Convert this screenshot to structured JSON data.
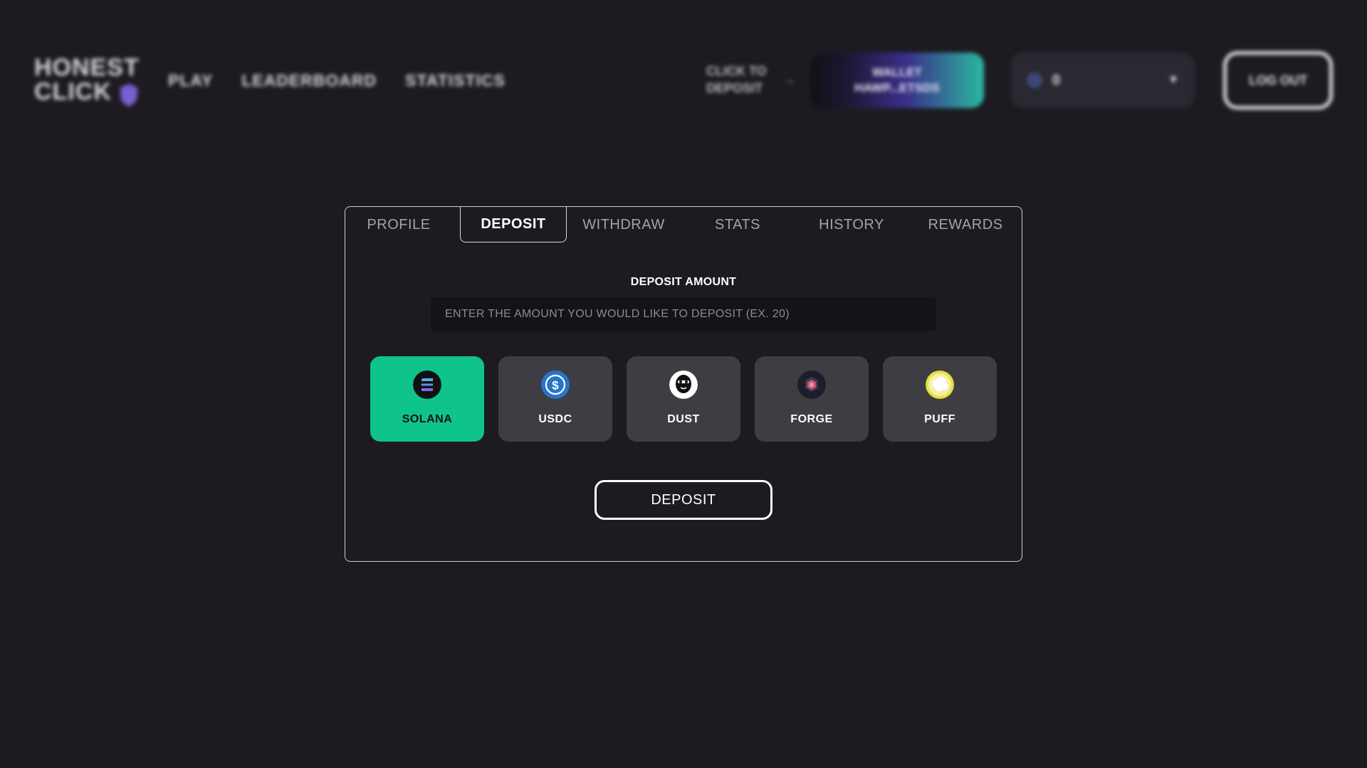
{
  "header": {
    "logo_line1": "HONEST",
    "logo_line2": "CLICK",
    "nav": [
      {
        "label": "PLAY"
      },
      {
        "label": "LEADERBOARD"
      },
      {
        "label": "STATISTICS"
      }
    ],
    "deposit_hint": "CLICK TO DEPOSIT",
    "deposit_hint_arrow": "→",
    "wallet_label": "WALLET",
    "wallet_address": "HAWP...ETSDS",
    "balance_value": "0",
    "balance_caret": "▼",
    "logout_label": "LOG OUT"
  },
  "tabs": [
    {
      "label": "PROFILE"
    },
    {
      "label": "DEPOSIT",
      "active": true
    },
    {
      "label": "WITHDRAW"
    },
    {
      "label": "STATS"
    },
    {
      "label": "HISTORY"
    },
    {
      "label": "REWARDS"
    }
  ],
  "deposit": {
    "amount_label": "DEPOSIT AMOUNT",
    "amount_value": "",
    "amount_placeholder": "ENTER THE AMOUNT YOU WOULD LIKE TO DEPOSIT (EX. 20)",
    "coins": [
      {
        "name": "SOLANA",
        "icon": "solana-icon",
        "selected": true
      },
      {
        "name": "USDC",
        "icon": "usdc-icon",
        "selected": false
      },
      {
        "name": "DUST",
        "icon": "dust-icon",
        "selected": false
      },
      {
        "name": "FORGE",
        "icon": "forge-icon",
        "selected": false
      },
      {
        "name": "PUFF",
        "icon": "puff-icon",
        "selected": false
      }
    ],
    "submit_label": "DEPOSIT"
  },
  "colors": {
    "background": "#1d1b21",
    "selected_coin": "#0ec48a",
    "coin_card": "#3f3d44",
    "input_bg": "#141317"
  }
}
